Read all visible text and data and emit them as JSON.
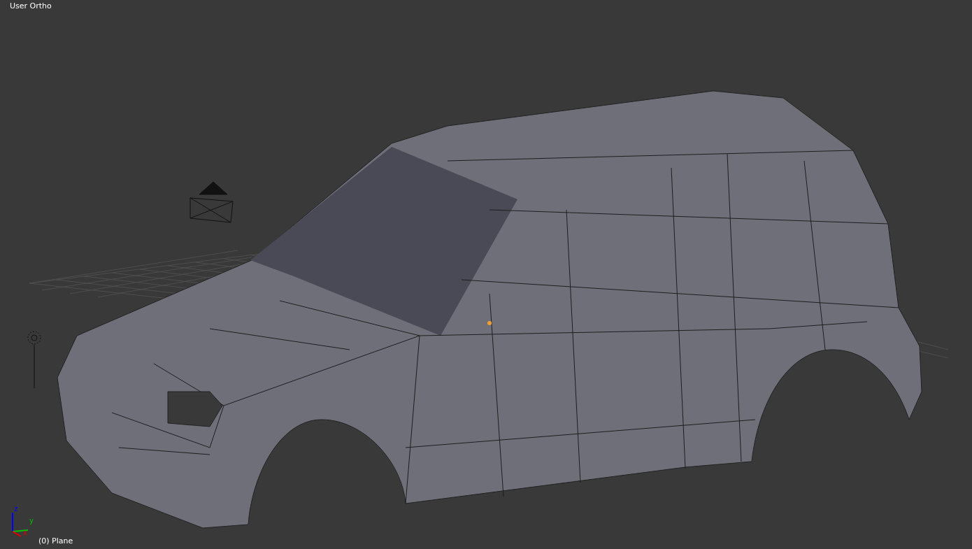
{
  "viewport": {
    "view_name": "User Ortho",
    "object_label": "(0) Plane",
    "axes": [
      {
        "label": "z",
        "color": "#0000ff"
      },
      {
        "label": "y",
        "color": "#00c000"
      },
      {
        "label": "x",
        "color": "#e00000"
      }
    ]
  }
}
